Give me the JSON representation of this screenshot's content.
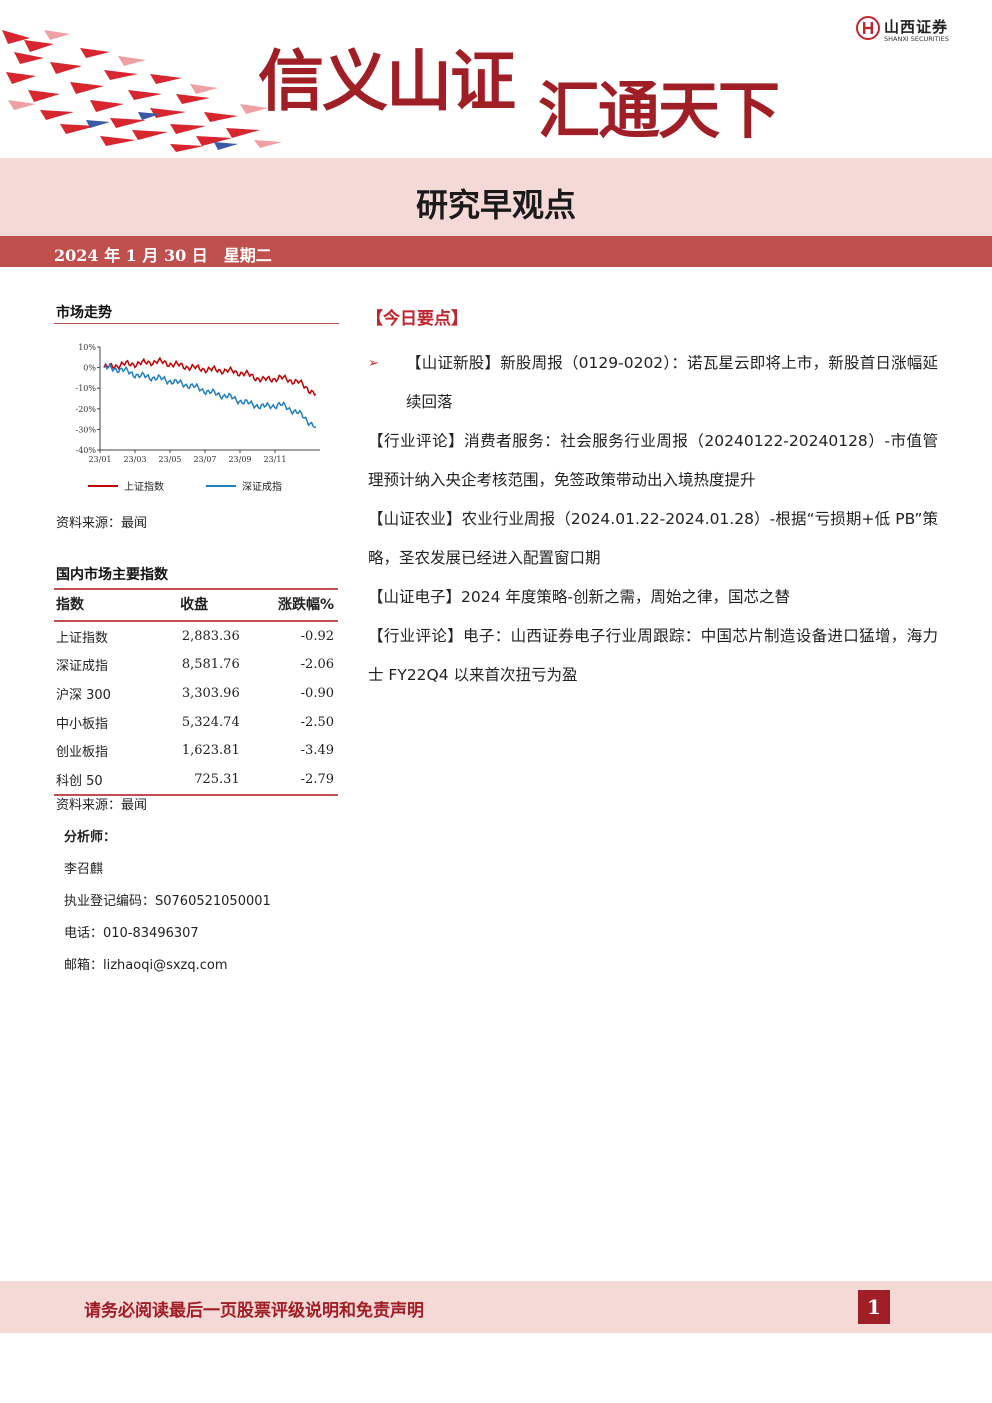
{
  "header": {
    "slogan_part1": "信义山证",
    "slogan_part2": "汇通天下",
    "logo_cn": "山西证券",
    "logo_en": "SHANXI SECURITIES"
  },
  "title": "研究早观点",
  "date_line": "2024 年 1 月 30 日　星期二",
  "market": {
    "heading": "市场走势",
    "source": "资料来源：最闻"
  },
  "chart_data": {
    "type": "line",
    "title": "",
    "ylabel": "",
    "xlabel": "",
    "y_ticks": [
      "10%",
      "0%",
      "-10%",
      "-20%",
      "-30%",
      "-40%"
    ],
    "x_ticks": [
      "23/01",
      "23/03",
      "23/05",
      "23/07",
      "23/09",
      "23/11"
    ],
    "ylim": [
      -40,
      10
    ],
    "legend_position": "bottom",
    "grid": false,
    "series": [
      {
        "name": "上证指数",
        "color": "#c00000",
        "x": [
          "23/01",
          "23/02",
          "23/03",
          "23/04",
          "23/05",
          "23/06",
          "23/07",
          "23/08",
          "23/09",
          "23/10",
          "23/11",
          "23/12",
          "24/01"
        ],
        "values": [
          0,
          1.5,
          2,
          3,
          1.5,
          0,
          -1,
          -1.5,
          -3,
          -6,
          -5,
          -7,
          -13
        ]
      },
      {
        "name": "深证成指",
        "color": "#1f7ebf",
        "x": [
          "23/01",
          "23/02",
          "23/03",
          "23/04",
          "23/05",
          "23/06",
          "23/07",
          "23/08",
          "23/09",
          "23/10",
          "23/11",
          "23/12",
          "24/01"
        ],
        "values": [
          0,
          -1,
          -4,
          -5,
          -7,
          -9,
          -12,
          -14,
          -17,
          -19,
          -18,
          -22,
          -29
        ]
      }
    ]
  },
  "indices": {
    "heading": "国内市场主要指数",
    "headers": [
      "指数",
      "收盘",
      "涨跌幅%"
    ],
    "rows": [
      {
        "name": "上证指数",
        "close": "2,883.36",
        "change": "-0.92"
      },
      {
        "name": "深证成指",
        "close": "8,581.76",
        "change": "-2.06"
      },
      {
        "name": "沪深 300",
        "close": "3,303.96",
        "change": "-0.90"
      },
      {
        "name": "中小板指",
        "close": "5,324.74",
        "change": "-2.50"
      },
      {
        "name": "创业板指",
        "close": "1,623.81",
        "change": "-3.49"
      },
      {
        "name": "科创 50",
        "close": "725.31",
        "change": "-2.79"
      }
    ],
    "source": "资料来源：最闻"
  },
  "analyst": {
    "heading": "分析师：",
    "name": "李召麒",
    "license": "执业登记编码：S0760521050001",
    "phone": "电话：010-83496307",
    "email": "邮箱：lizhaoqi@sxzq.com"
  },
  "key_points": {
    "heading": "【今日要点】",
    "items": [
      "【山证新股】新股周报（0129-0202）：诺瓦星云即将上市，新股首日涨幅延续回落",
      "【行业评论】消费者服务：社会服务行业周报（20240122-20240128）-市值管理预计纳入央企考核范围，免签政策带动出入境热度提升",
      "【山证农业】农业行业周报（2024.01.22-2024.01.28）-根据“亏损期+低 PB”策略，圣农发展已经进入配置窗口期",
      "【山证电子】2024 年度策略-创新之需，周始之律，国芯之替",
      "【行业评论】电子：山西证券电子行业周跟踪：中国芯片制造设备进口猛增，海力士 FY22Q4 以来首次扭亏为盈"
    ]
  },
  "footer": {
    "disclaimer": "请务必阅读最后一页股票评级说明和免责声明",
    "page": "1"
  }
}
